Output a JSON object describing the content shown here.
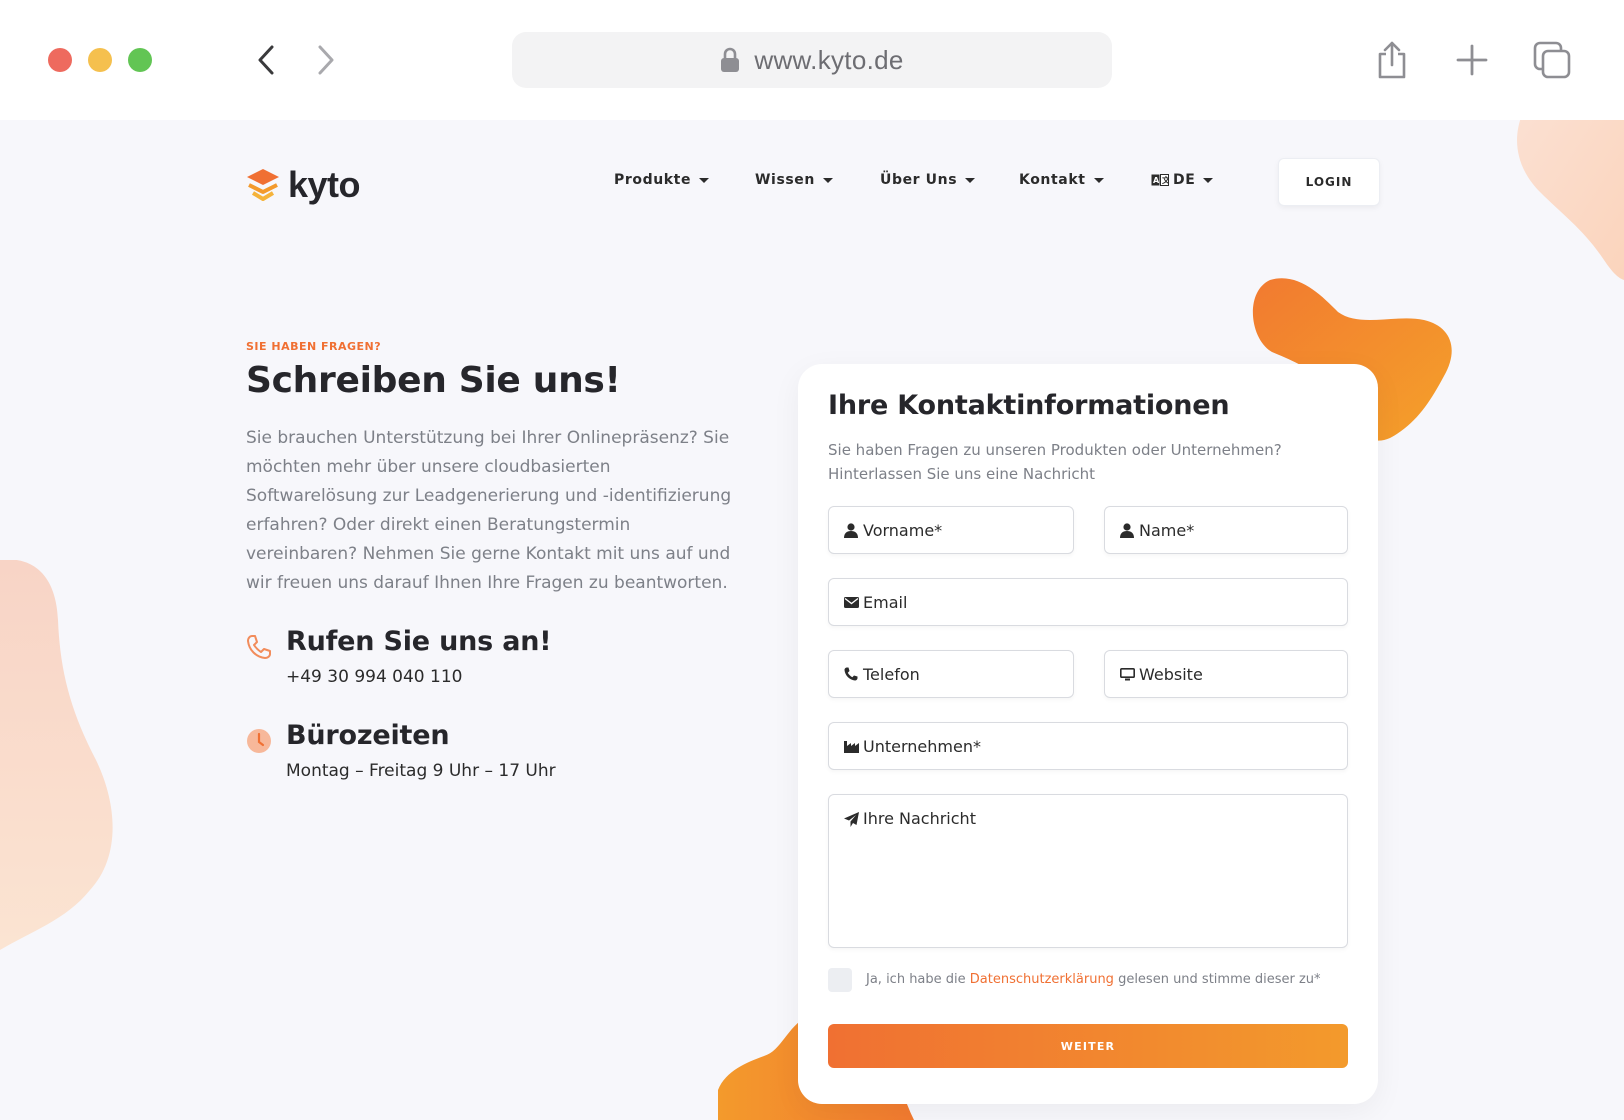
{
  "browser": {
    "url": "www.kyto.de",
    "icons": [
      "back-icon",
      "forward-icon",
      "lock-icon",
      "share-icon",
      "plus-icon",
      "tabs-icon"
    ]
  },
  "site": {
    "logo_text": "kyto",
    "nav": {
      "items": [
        {
          "label": "Produkte"
        },
        {
          "label": "Wissen"
        },
        {
          "label": "Über Uns"
        },
        {
          "label": "Kontakt"
        },
        {
          "label": "DE"
        }
      ],
      "login_label": "LOGIN"
    },
    "colors": {
      "accent": "#f07033",
      "accent_end": "#f39a2c",
      "background": "#f7f7fb",
      "text": "#26262b"
    }
  },
  "hero": {
    "eyebrow": "SIE HABEN FRAGEN?",
    "headline": "Schreiben Sie uns!",
    "intro": "Sie brauchen Unterstützung bei Ihrer Onlinepräsenz? Sie möchten mehr über unsere cloudbasierten Softwarelösung zur Leadgenerierung und -identifizierung erfahren? Oder direkt einen Beratungstermin vereinbaren? Nehmen Sie gerne Kontakt mit uns auf und wir freuen uns darauf Ihnen Ihre Fragen zu beantworten."
  },
  "contact": {
    "phone_title": "Rufen Sie uns an!",
    "phone_value": "+49 30 994 040 110",
    "hours_title": "Bürozeiten",
    "hours_value": "Montag – Freitag  9 Uhr – 17 Uhr"
  },
  "form": {
    "title": "Ihre Kontaktinformationen",
    "subtitle": "Sie haben Fragen zu unseren Produkten oder Unternehmen? Hinterlassen Sie uns eine Nachricht",
    "fields": {
      "first_name": "Vorname*",
      "last_name": "Name*",
      "email": "Email",
      "phone": "Telefon",
      "website": "Website",
      "company": "Unternehmen*",
      "message": "Ihre Nachricht"
    },
    "consent_before": "Ja, ich habe die ",
    "consent_link": "Datenschutzerklärung",
    "consent_after": " gelesen und stimme dieser zu*",
    "submit_label": "WEITER"
  }
}
